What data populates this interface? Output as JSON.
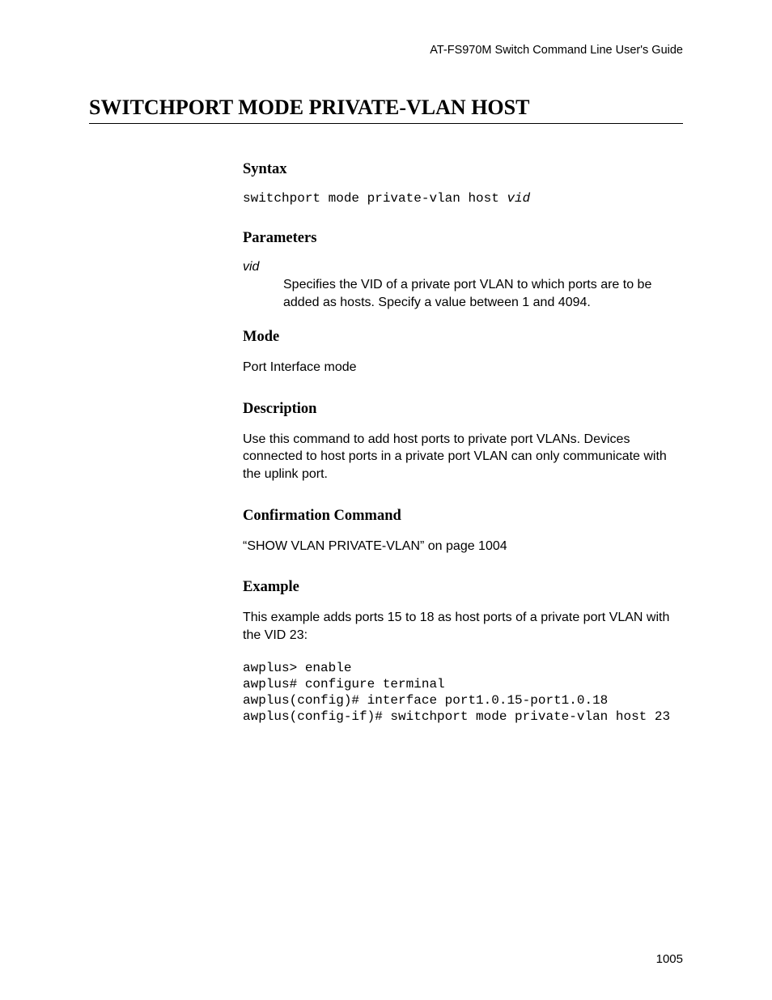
{
  "header": {
    "guide_title": "AT-FS970M Switch Command Line User's Guide"
  },
  "title": "SWITCHPORT MODE PRIVATE-VLAN HOST",
  "sections": {
    "syntax": {
      "heading": "Syntax",
      "command_base": "switchport mode private-vlan host ",
      "command_arg": "vid"
    },
    "parameters": {
      "heading": "Parameters",
      "term": "vid",
      "desc": "Specifies the VID of a private port VLAN to which ports are to be added as hosts. Specify a value between 1 and 4094."
    },
    "mode": {
      "heading": "Mode",
      "body": "Port Interface mode"
    },
    "description": {
      "heading": "Description",
      "body": "Use this command to add host ports to private port VLANs. Devices connected to host ports in a private port VLAN can only communicate with the uplink port."
    },
    "confirmation": {
      "heading": "Confirmation Command",
      "body": "“SHOW VLAN PRIVATE-VLAN” on page 1004"
    },
    "example": {
      "heading": "Example",
      "intro": "This example adds ports 15 to 18 as host ports of a private port VLAN with the VID 23:",
      "code": "awplus> enable\nawplus# configure terminal\nawplus(config)# interface port1.0.15-port1.0.18\nawplus(config-if)# switchport mode private-vlan host 23"
    }
  },
  "page_number": "1005"
}
